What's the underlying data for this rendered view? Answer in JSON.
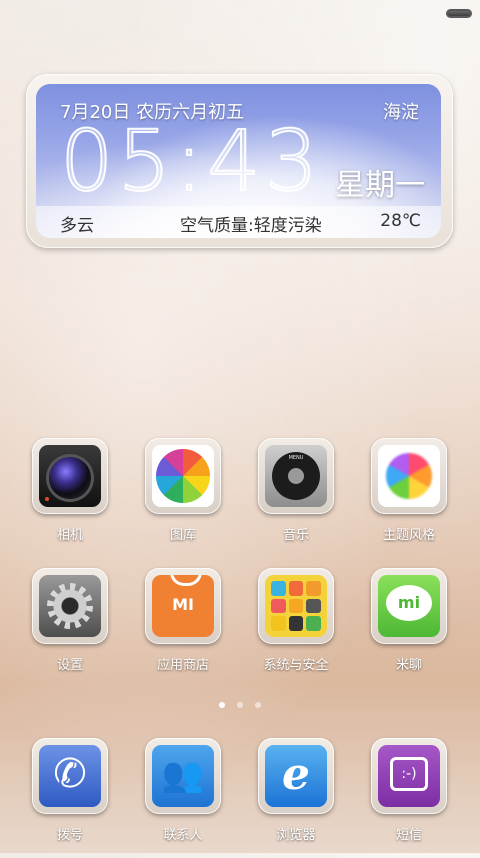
{
  "widget": {
    "date": "7月20日",
    "lunar": "农历六月初五",
    "city": "海淀",
    "time": "05:43",
    "weekday": "星期一",
    "condition": "多云",
    "air_quality": "空气质量:轻度污染",
    "temperature": "28℃"
  },
  "apps_row1": [
    {
      "label": "相机",
      "icon": "camera-icon"
    },
    {
      "label": "图库",
      "icon": "gallery-icon"
    },
    {
      "label": "音乐",
      "icon": "music-icon"
    },
    {
      "label": "主题风格",
      "icon": "theme-icon"
    }
  ],
  "apps_row2": [
    {
      "label": "设置",
      "icon": "settings-icon"
    },
    {
      "label": "应用商店",
      "icon": "app-store-icon"
    },
    {
      "label": "系统与安全",
      "icon": "security-icon"
    },
    {
      "label": "米聊",
      "icon": "michat-icon"
    }
  ],
  "dock": [
    {
      "label": "拨号",
      "icon": "phone-icon"
    },
    {
      "label": "联系人",
      "icon": "contacts-icon"
    },
    {
      "label": "浏览器",
      "icon": "browser-icon"
    },
    {
      "label": "短信",
      "icon": "sms-icon"
    }
  ],
  "icon_text": {
    "music_menu": "MENU",
    "store_mi": "MI",
    "michat_mi": "mi",
    "sms_face": ":-)"
  },
  "pager": {
    "pages": 3,
    "current": 1
  }
}
